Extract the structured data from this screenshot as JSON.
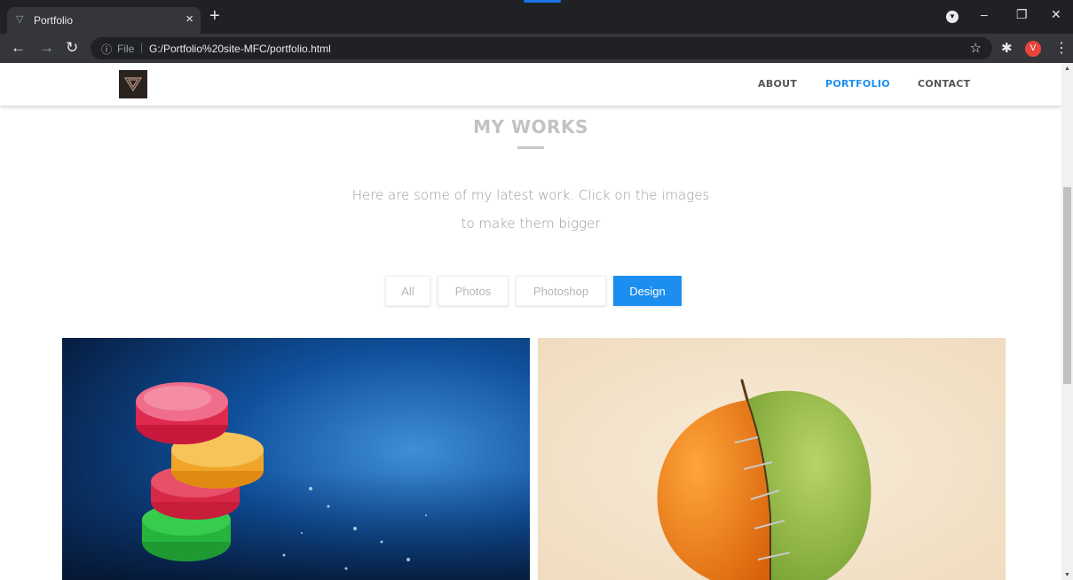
{
  "browser": {
    "tab_title": "Portfolio",
    "tab_close": "×",
    "new_tab": "+",
    "address_scheme": "File",
    "address_url": "G:/Portfolio%20site-MFC/portfolio.html",
    "profile_initial": "V",
    "icons": [
      "back-icon",
      "forward-icon",
      "reload-icon",
      "info-icon",
      "star-icon",
      "extensions-icon",
      "menu-icon"
    ]
  },
  "site": {
    "nav": [
      {
        "label": "ABOUT",
        "active": false
      },
      {
        "label": "PORTFOLIO",
        "active": true
      },
      {
        "label": "CONTACT",
        "active": false
      }
    ],
    "section_title": "MY WORKS",
    "intro_line1": "Here are some of my latest work. Click on the images",
    "intro_line2": "to make them bigger",
    "filters": [
      {
        "label": "All",
        "active": false
      },
      {
        "label": "Photos",
        "active": false
      },
      {
        "label": "Photoshop",
        "active": false
      },
      {
        "label": "Design",
        "active": true
      }
    ],
    "gallery": [
      {
        "subject": "stacked colorful gummy candies on blue background"
      },
      {
        "subject": "half orange half green apple stitched together"
      }
    ]
  },
  "colors": {
    "accent": "#1c8ef0",
    "chrome_dark": "#202124",
    "chrome_toolbar": "#35363a"
  }
}
